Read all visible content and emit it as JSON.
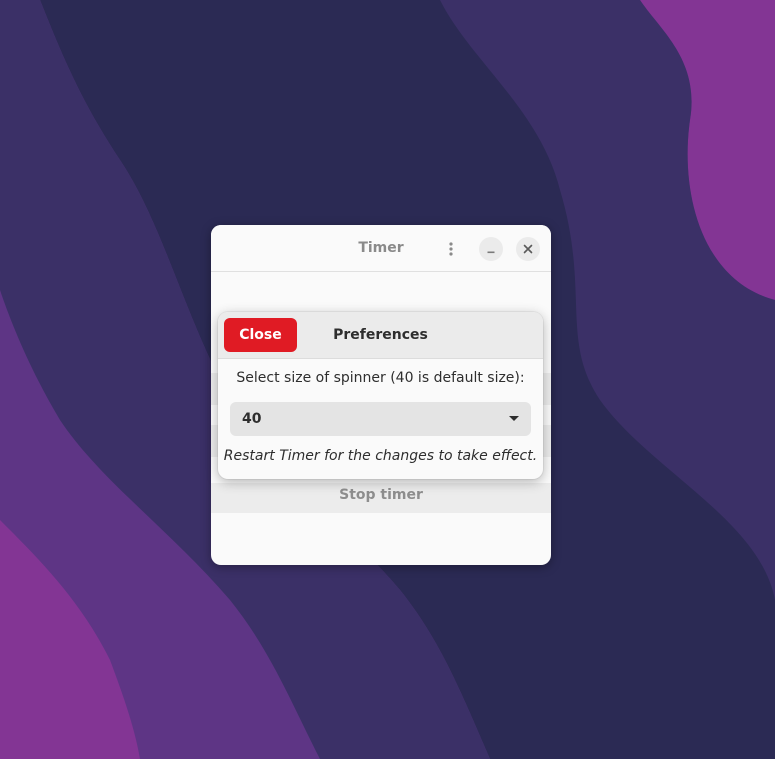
{
  "desktop": {
    "colors": [
      "#2b2a54",
      "#3b3067",
      "#5e3585",
      "#833594"
    ]
  },
  "window": {
    "title": "Timer",
    "menu_icon": "kebab-menu-icon",
    "minimize_icon": "minimize-icon",
    "close_icon": "close-icon",
    "stop_timer_label": "Stop timer"
  },
  "preferences": {
    "close_label": "Close",
    "title": "Preferences",
    "spinner_label": "Select size of spinner (40 is default size):",
    "spinner_size_value": "40",
    "restart_note": "Restart Timer for the changes to take effect.",
    "accent_color": "#e01b24"
  }
}
